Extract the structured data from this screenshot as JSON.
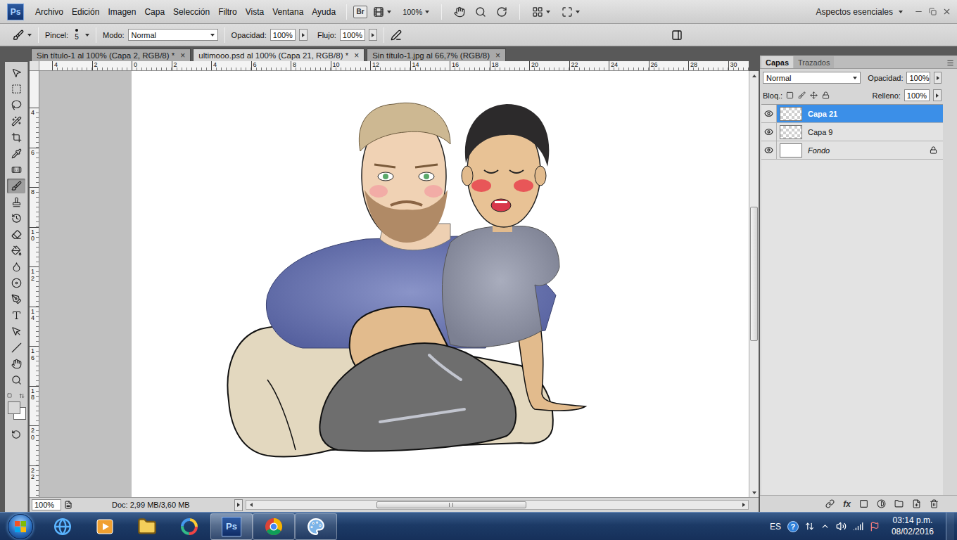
{
  "app": {
    "logo": "Ps"
  },
  "menu": [
    "Archivo",
    "Edición",
    "Imagen",
    "Capa",
    "Selección",
    "Filtro",
    "Vista",
    "Ventana",
    "Ayuda"
  ],
  "app_bar": {
    "bridge": "Br",
    "zoom": "100%",
    "workspace": "Aspectos esenciales"
  },
  "options_bar": {
    "brush_label": "Pincel:",
    "brush_size": "5",
    "mode_label": "Modo:",
    "mode": "Normal",
    "opacity_label": "Opacidad:",
    "opacity": "100%",
    "flow_label": "Flujo:",
    "flow": "100%"
  },
  "document_tabs": [
    {
      "label": "Sin título-1 al 100% (Capa 2, RGB/8) *",
      "selected": false,
      "close": "×"
    },
    {
      "label": "ultimooo.psd al 100% (Capa 21, RGB/8) *",
      "selected": true,
      "close": "×"
    },
    {
      "label": "Sin título-1.jpg al 66,7% (RGB/8)",
      "selected": false,
      "close": "×"
    }
  ],
  "tools": [
    {
      "kind": "move",
      "selected": false
    },
    {
      "kind": "marquee",
      "selected": false
    },
    {
      "kind": "lasso",
      "selected": false
    },
    {
      "kind": "wand",
      "selected": false
    },
    {
      "kind": "crop",
      "selected": false
    },
    {
      "kind": "eyedropper",
      "selected": false
    },
    {
      "kind": "healing",
      "selected": false
    },
    {
      "kind": "brush",
      "selected": true
    },
    {
      "kind": "stamp",
      "selected": false
    },
    {
      "kind": "history",
      "selected": false
    },
    {
      "kind": "eraser",
      "selected": false
    },
    {
      "kind": "bucket",
      "selected": false
    },
    {
      "kind": "blur",
      "selected": false
    },
    {
      "kind": "dodge",
      "selected": false
    },
    {
      "kind": "pen",
      "selected": false
    },
    {
      "kind": "type",
      "selected": false
    },
    {
      "kind": "path-select",
      "selected": false
    },
    {
      "kind": "line",
      "selected": false
    },
    {
      "kind": "hand",
      "selected": false
    },
    {
      "kind": "zoom",
      "selected": false
    }
  ],
  "rulers": {
    "top": [
      "4",
      "2",
      "0",
      "2",
      "4",
      "6",
      "8",
      "10",
      "12",
      "14",
      "16",
      "18",
      "20",
      "22",
      "24",
      "26",
      "28",
      "30"
    ],
    "left": [
      "4",
      "6",
      "8",
      "10",
      "12",
      "14",
      "16",
      "18",
      "20",
      "22"
    ]
  },
  "scrollbars": {
    "vertical": {
      "start": 0.31,
      "size": 0.33
    },
    "horizontal": {
      "start": 0.25,
      "size": 0.31
    }
  },
  "status_bar": {
    "zoom": "100%",
    "document": "Doc: 2,99 MB/3,60 MB"
  },
  "layers_panel": {
    "tabs": [
      {
        "label": "Capas",
        "selected": true
      },
      {
        "label": "Trazados",
        "selected": false
      }
    ],
    "blend_mode": "Normal",
    "opacity_label": "Opacidad:",
    "opacity": "100%",
    "lock_label": "Bloq.:",
    "fill_label": "Relleno:",
    "fill": "100%",
    "layers": [
      {
        "name": "Capa 21",
        "kind": "layer",
        "visible": true,
        "selected": true,
        "locked": false
      },
      {
        "name": "Capa 9",
        "kind": "layer",
        "visible": true,
        "selected": false,
        "locked": false
      },
      {
        "name": "Fondo",
        "kind": "background",
        "visible": true,
        "selected": false,
        "locked": true
      }
    ],
    "effects_label": "fx"
  },
  "taskbar": {
    "apps": [
      {
        "kind": "ie",
        "running": false,
        "selected": false,
        "label": ""
      },
      {
        "kind": "media",
        "running": false,
        "selected": false,
        "label": ""
      },
      {
        "kind": "explorer",
        "running": false,
        "selected": false,
        "label": ""
      },
      {
        "kind": "ring",
        "running": false,
        "selected": false,
        "label": ""
      },
      {
        "kind": "photoshop",
        "running": true,
        "selected": true,
        "label": "Ps"
      },
      {
        "kind": "chrome",
        "running": true,
        "selected": false,
        "label": ""
      },
      {
        "kind": "paint",
        "running": true,
        "selected": false,
        "label": ""
      }
    ],
    "language": "ES",
    "help": "?",
    "time": "03:14 p.m.",
    "date": "08/02/2016"
  }
}
